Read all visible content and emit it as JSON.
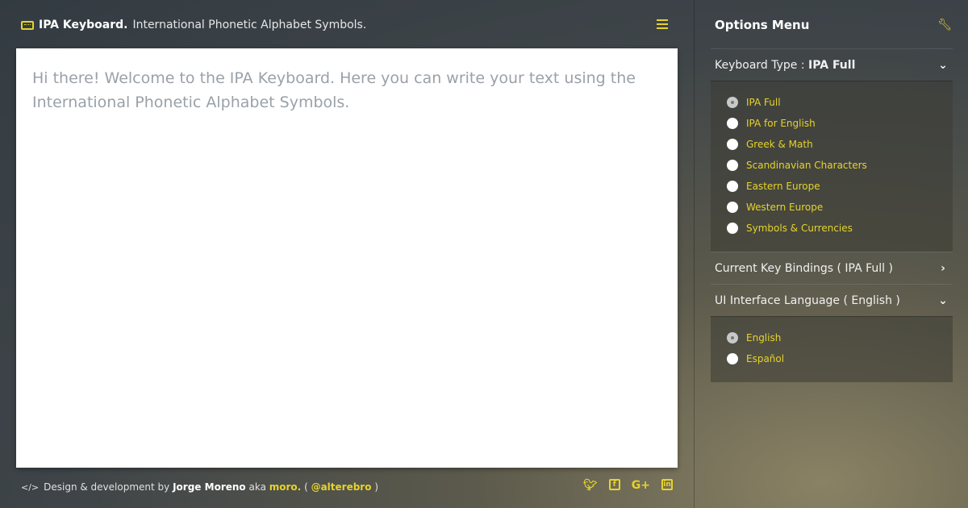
{
  "header": {
    "brand": "IPA Keyboard.",
    "tagline": "International Phonetic Alphabet Symbols."
  },
  "editor": {
    "text": "Hi there! Welcome to the IPA Keyboard. Here you can write your text using the International Phonetic Alphabet Symbols."
  },
  "footer": {
    "prefix": "Design & development by",
    "author": "Jorge Moreno",
    "aka": "aka",
    "nick": "moro.",
    "open": "(",
    "handle": "@alterebro",
    "close": ")",
    "social": [
      "twitter-icon",
      "facebook-icon",
      "google-plus-icon",
      "linkedin-icon"
    ]
  },
  "sidebar": {
    "title": "Options Menu",
    "keyboard_type": {
      "label": "Keyboard Type :",
      "value": "IPA Full",
      "options": [
        {
          "label": "IPA Full",
          "selected": true
        },
        {
          "label": "IPA for English",
          "selected": false
        },
        {
          "label": "Greek & Math",
          "selected": false
        },
        {
          "label": "Scandinavian Characters",
          "selected": false
        },
        {
          "label": "Eastern Europe",
          "selected": false
        },
        {
          "label": "Western Europe",
          "selected": false
        },
        {
          "label": "Symbols & Currencies",
          "selected": false
        }
      ]
    },
    "key_bindings": {
      "label": "Current Key Bindings ( IPA Full )"
    },
    "ui_language": {
      "label": "UI Interface Language ( English )",
      "options": [
        {
          "label": "English",
          "selected": true
        },
        {
          "label": "Español",
          "selected": false
        }
      ]
    }
  },
  "colors": {
    "accent": "#e6d32b",
    "editor_text": "#9aa1a8"
  }
}
